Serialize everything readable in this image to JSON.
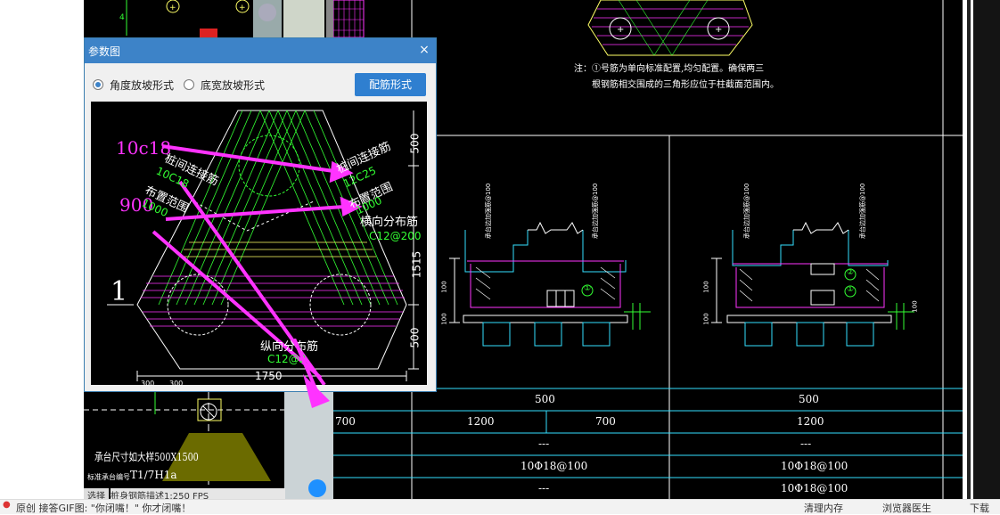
{
  "dialog": {
    "title": "参数图",
    "close_label": "×",
    "radio_options": [
      "角度放坡形式",
      "底宽放坡形式"
    ],
    "selected_option": "角度放坡形式",
    "rebar_button_label": "配筋形式"
  },
  "preview": {
    "annotations": [
      "10c18",
      "900",
      "1",
      "桩间连接筋",
      "10C18",
      "布置范围",
      "1000",
      "桩间连接筋",
      "12C25",
      "布置范围",
      "1000",
      "横向分布筋",
      "C12@200",
      "纵向分布筋",
      "C12@2",
      "1750",
      "500",
      "1515",
      "500",
      "300",
      "300"
    ]
  },
  "drawing": {
    "note_line1": "注：①号筋为单向标准配置,均匀配置。确保两三",
    "note_line2": "根钢筋相交围成的三角形应位于柱截面范围内。",
    "table_rows": [
      [
        "",
        "500",
        "",
        "500"
      ],
      [
        "700",
        "1200",
        "700",
        "1200"
      ],
      [
        "",
        "---",
        "",
        "---"
      ],
      [
        "",
        "10Φ18@100",
        "",
        "10Φ18@100"
      ],
      [
        "",
        "---",
        "",
        "10Φ18@100"
      ]
    ],
    "left_label_size": "承台尺寸如大样500X1500",
    "left_label_code": "T1/7H1a",
    "left_label_prefix": "标准承台编号",
    "left_tab1": "选择",
    "left_tab2": "桩身钢筋描述1:250 FPS",
    "circle_labels": [
      "①",
      "①",
      "②"
    ],
    "dims_vertical": [
      "100",
      "100",
      "100",
      "100",
      "100"
    ]
  },
  "statusbar": {
    "text": "原创 接答GIF图: \"你闭嘴！\" 你才闭嘴！",
    "clean_label": "清理内存",
    "doctor_label": "浏览器医生",
    "extra_label": "下载"
  },
  "colors": {
    "cad_bg": "#000000",
    "dialog_titlebar": "#3d83c8",
    "magenta": "#ff33ff",
    "green": "#33ff33",
    "cyan": "#33e0ff",
    "white": "#ffffff",
    "yellow": "#ffff66"
  }
}
